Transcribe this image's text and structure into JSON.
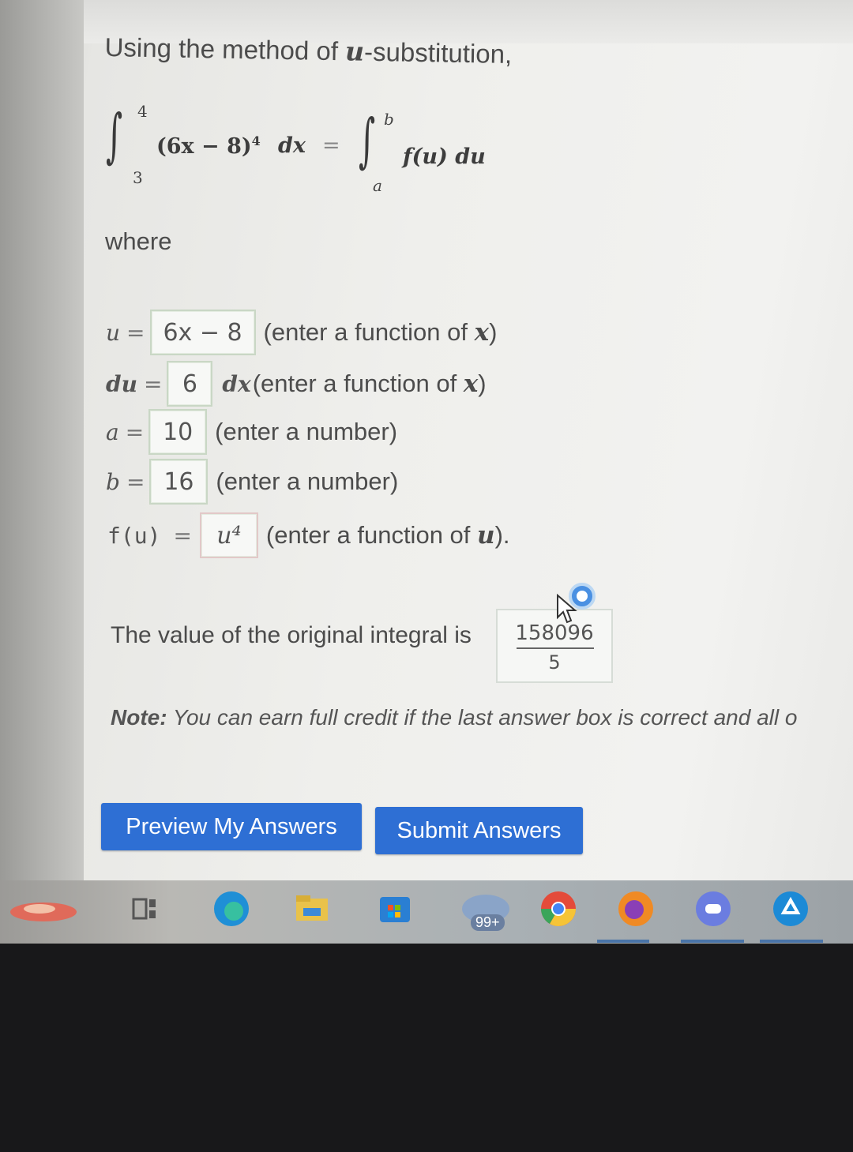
{
  "intro": {
    "prefix": "Using the method of ",
    "var": "u",
    "suffix": "-substitution,"
  },
  "formula": {
    "left_upper": "4",
    "left_lower": "3",
    "integrand": "(6x − 8)",
    "exponent": "4",
    "dx": "dx",
    "equals": "=",
    "right_upper": "b",
    "right_lower": "a",
    "right_integrand": "f(u) du"
  },
  "where_label": "where",
  "fields": [
    {
      "label": "u",
      "value": "6x − 8",
      "hint_prefix": "(enter a function of ",
      "hint_var": "x",
      "hint_suffix": ")"
    },
    {
      "label": "du",
      "value": "6",
      "after": "dx",
      "hint_prefix": " (enter a function of ",
      "hint_var": "x",
      "hint_suffix": ")"
    },
    {
      "label": "a",
      "value": "10",
      "hint_prefix": "(enter a number)",
      "hint_var": "",
      "hint_suffix": ""
    },
    {
      "label": "b",
      "value": "16",
      "hint_prefix": "(enter a number)",
      "hint_var": "",
      "hint_suffix": ""
    },
    {
      "label": "f(u)",
      "value": "u⁴",
      "hint_prefix": "(enter a function of ",
      "hint_var": "u",
      "hint_suffix": ")."
    }
  ],
  "result": {
    "text": "The value of the original integral is",
    "numerator": "158096",
    "denominator": "5"
  },
  "note": {
    "bold": "Note:",
    "text": " You can earn full credit if the last answer box is correct and all o"
  },
  "buttons": {
    "preview": "Preview My Answers",
    "submit": "Submit Answers"
  },
  "taskbar": {
    "mail_badge": "99+"
  },
  "colors": {
    "button_blue": "#2e6fd4",
    "status_blue": "#4a90e2"
  }
}
